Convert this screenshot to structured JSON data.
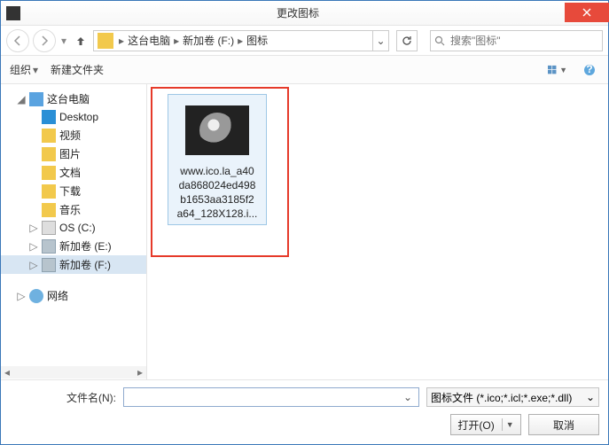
{
  "title": "更改图标",
  "breadcrumb": {
    "segments": [
      "这台电脑",
      "新加卷 (F:)",
      "图标"
    ]
  },
  "search": {
    "placeholder": "搜索\"图标\""
  },
  "toolbar": {
    "organize": "组织",
    "newfolder": "新建文件夹"
  },
  "sidebar": {
    "expanded_caret": "◢",
    "collapsed_caret": "▷",
    "pc": "这台电脑",
    "items": [
      {
        "label": "Desktop",
        "icon": "desktop"
      },
      {
        "label": "视频",
        "icon": "folder"
      },
      {
        "label": "图片",
        "icon": "folder"
      },
      {
        "label": "文档",
        "icon": "folder"
      },
      {
        "label": "下载",
        "icon": "folder"
      },
      {
        "label": "音乐",
        "icon": "folder"
      },
      {
        "label": "OS (C:)",
        "icon": "os"
      },
      {
        "label": "新加卷 (E:)",
        "icon": "drive"
      },
      {
        "label": "新加卷 (F:)",
        "icon": "drive",
        "selected": true
      }
    ],
    "network": "网络"
  },
  "file": {
    "lines": [
      "www.ico.la_a40",
      "da868024ed498",
      "b1653aa3185f2",
      "a64_128X128.i..."
    ]
  },
  "footer": {
    "filename_label": "文件名(N):",
    "filename_value": "",
    "filter": "图标文件 (*.ico;*.icl;*.exe;*.dll)",
    "open": "打开(O)",
    "cancel": "取消"
  }
}
